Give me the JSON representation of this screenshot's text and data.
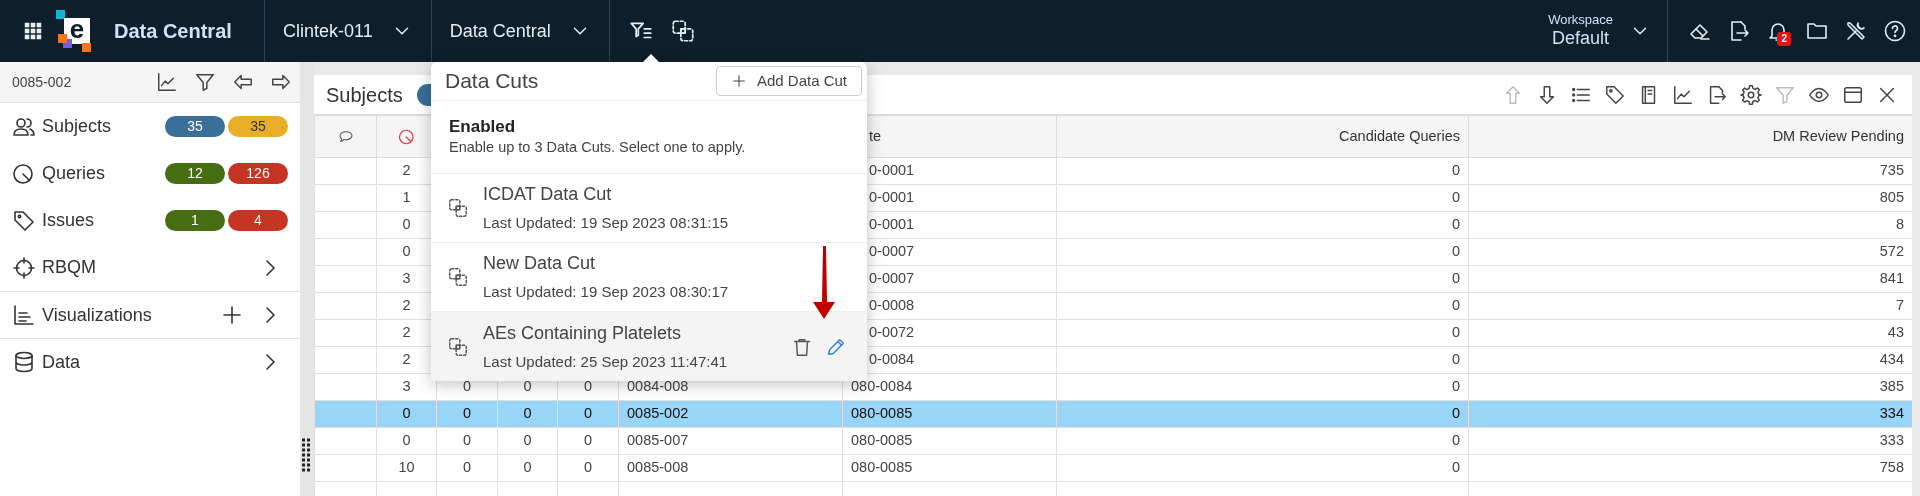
{
  "topbar": {
    "logo_letter": "e",
    "brand": "Data Central",
    "selectors": [
      {
        "label": "Clintek-011"
      },
      {
        "label": "Data Central"
      }
    ],
    "tools": [
      {
        "kind": "filter-list"
      },
      {
        "kind": "data-cuts"
      }
    ],
    "workspace": {
      "label": "Workspace",
      "value": "Default"
    },
    "actions": [
      {
        "kind": "eraser"
      },
      {
        "kind": "export"
      },
      {
        "kind": "bell",
        "badge": "2"
      },
      {
        "kind": "folder"
      },
      {
        "kind": "tools"
      },
      {
        "kind": "help"
      }
    ]
  },
  "sidebar": {
    "subject_id": "0085-002",
    "header_tools": [
      {
        "kind": "chart"
      },
      {
        "kind": "filter"
      },
      {
        "kind": "arrow-left"
      },
      {
        "kind": "arrow-right"
      }
    ],
    "items": [
      {
        "kind": "counts",
        "label": "Subjects",
        "badges": [
          {
            "text": "35",
            "color": "#3b6f99"
          },
          {
            "text": "35",
            "color": "#e9ae27"
          }
        ]
      },
      {
        "kind": "counts",
        "label": "Queries",
        "badges": [
          {
            "text": "12",
            "color": "#476d13"
          },
          {
            "text": "126",
            "color": "#c63423"
          }
        ]
      },
      {
        "kind": "counts",
        "label": "Issues",
        "badges": [
          {
            "text": "1",
            "color": "#476d13"
          },
          {
            "text": "4",
            "color": "#c63423"
          }
        ]
      },
      {
        "kind": "menu",
        "label": "RBQM",
        "addable": false
      },
      {
        "kind": "menu",
        "label": "Visualizations",
        "addable": true
      },
      {
        "kind": "menu",
        "label": "Data",
        "addable": false
      }
    ]
  },
  "panel": {
    "title": "Subjects",
    "toolbar": [
      {
        "kind": "arrow-up",
        "disabled": true
      },
      {
        "kind": "arrow-down",
        "disabled": false
      },
      {
        "kind": "list",
        "disabled": false
      },
      {
        "kind": "tag",
        "disabled": false
      },
      {
        "kind": "book",
        "disabled": false
      },
      {
        "kind": "chart",
        "disabled": false
      },
      {
        "kind": "export",
        "disabled": false
      },
      {
        "kind": "gear",
        "disabled": false
      },
      {
        "kind": "filter",
        "disabled": true
      },
      {
        "kind": "eye",
        "disabled": false
      },
      {
        "kind": "panel",
        "disabled": false
      },
      {
        "kind": "close",
        "disabled": false
      }
    ]
  },
  "table": {
    "headers": {
      "column_7": "te",
      "candidate_queries": "Candidate Queries",
      "dm_review_pending": "DM Review Pending"
    },
    "rows": [
      {
        "selected": false,
        "queries": "2",
        "site": "0-0001",
        "candidate_queries": "0",
        "dm_review_pending": "735"
      },
      {
        "selected": false,
        "queries": "1",
        "site": "0-0001",
        "candidate_queries": "0",
        "dm_review_pending": "805"
      },
      {
        "selected": false,
        "queries": "0",
        "site": "0-0001",
        "candidate_queries": "0",
        "dm_review_pending": "8"
      },
      {
        "selected": false,
        "queries": "0",
        "site": "0-0007",
        "candidate_queries": "0",
        "dm_review_pending": "572"
      },
      {
        "selected": false,
        "queries": "3",
        "site": "0-0007",
        "candidate_queries": "0",
        "dm_review_pending": "841"
      },
      {
        "selected": false,
        "queries": "2",
        "site": "0-0008",
        "candidate_queries": "0",
        "dm_review_pending": "7"
      },
      {
        "selected": false,
        "queries": "2",
        "site": "0-0072",
        "candidate_queries": "0",
        "dm_review_pending": "43"
      },
      {
        "selected": false,
        "queries": "2",
        "site": "0-0084",
        "candidate_queries": "0",
        "dm_review_pending": "434"
      },
      {
        "selected": false,
        "queries": "3",
        "column_3": "0",
        "column_4": "0",
        "column_5": "0",
        "subject": "0084-008",
        "site": "080-0084",
        "candidate_queries": "0",
        "dm_review_pending": "385"
      },
      {
        "selected": true,
        "queries": "0",
        "column_3": "0",
        "column_4": "0",
        "column_5": "0",
        "subject": "0085-002",
        "site": "080-0085",
        "candidate_queries": "0",
        "dm_review_pending": "334"
      },
      {
        "selected": false,
        "queries": "0",
        "column_3": "0",
        "column_4": "0",
        "column_5": "0",
        "subject": "0085-007",
        "site": "080-0085",
        "candidate_queries": "0",
        "dm_review_pending": "333"
      },
      {
        "selected": false,
        "queries": "10",
        "column_3": "0",
        "column_4": "0",
        "column_5": "0",
        "subject": "0085-008",
        "site": "080-0085",
        "candidate_queries": "0",
        "dm_review_pending": "758"
      }
    ]
  },
  "data_cuts": {
    "title": "Data Cuts",
    "add_button": "Add Data Cut",
    "section_title": "Enabled",
    "section_hint": "Enable up to 3 Data Cuts. Select one to apply.",
    "items": [
      {
        "name": "ICDAT Data Cut",
        "updated": "Last Updated: 19 Sep 2023 08:31:15",
        "highlighted": false
      },
      {
        "name": "New Data Cut",
        "updated": "Last Updated: 19 Sep 2023 08:30:17",
        "highlighted": false
      },
      {
        "name": "AEs Containing Platelets",
        "updated": "Last Updated: 25 Sep 2023 11:47:41",
        "highlighted": true
      }
    ]
  }
}
